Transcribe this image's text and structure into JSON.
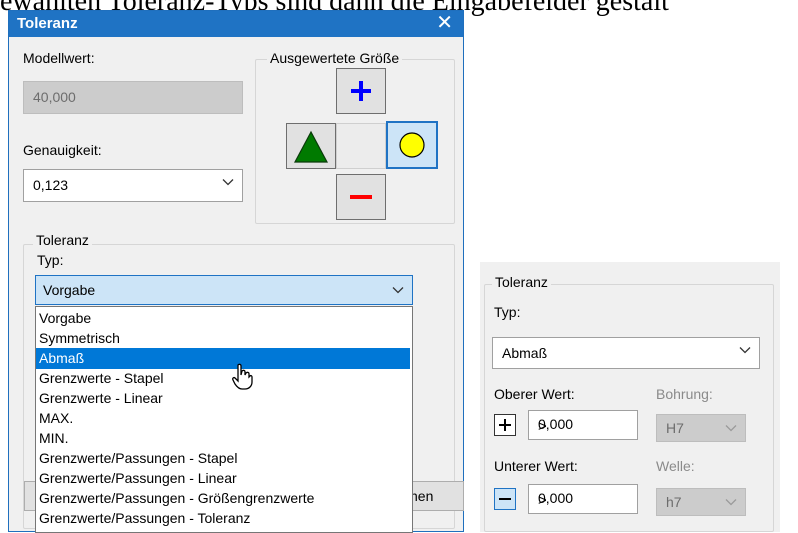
{
  "background_text": "ewählten Toleranz-Typs sind dann die Eingabefelder gestalt",
  "dialog": {
    "title": "Toleranz",
    "close_glyph": "✕",
    "model_value_label": "Modellwert:",
    "model_value": "40,000",
    "accuracy_label": "Genauigkeit:",
    "accuracy_value": "0,123",
    "evaluated_size_legend": "Ausgewertete Größe",
    "tolerance_legend": "Toleranz",
    "type_label": "Typ:",
    "type_value": "Vorgabe",
    "dropdown_options": [
      "Vorgabe",
      "Symmetrisch",
      "Abmaß",
      "Grenzwerte - Stapel",
      "Grenzwerte - Linear",
      "MAX.",
      "MIN.",
      "Grenzwerte/Passungen - Stapel",
      "Grenzwerte/Passungen - Linear",
      "Grenzwerte/Passungen - Größengrenzwerte",
      "Grenzwerte/Passungen - Toleranz"
    ],
    "selected_option_index": 2,
    "partial_button_label": "hen"
  },
  "panel2": {
    "tolerance_legend": "Toleranz",
    "type_label": "Typ:",
    "type_value": "Abmaß",
    "upper_label": "Oberer Wert:",
    "upper_value": "0,000",
    "bore_label": "Bohrung:",
    "bore_value": "H7",
    "lower_label": "Unterer Wert:",
    "lower_value": "0,000",
    "shaft_label": "Welle:",
    "shaft_value": "h7",
    "arrow_glyph": ">"
  },
  "colors": {
    "titlebar": "#1f73c4",
    "selection": "#0078d7",
    "plus": "#0000ff",
    "minus": "#ff0000",
    "triangle": "#007a00",
    "circle": "#ffff00"
  },
  "icons": [
    "close-icon",
    "plus-icon",
    "minus-icon",
    "triangle-icon",
    "circle-icon",
    "chevron-down-icon",
    "hand-cursor-icon"
  ]
}
